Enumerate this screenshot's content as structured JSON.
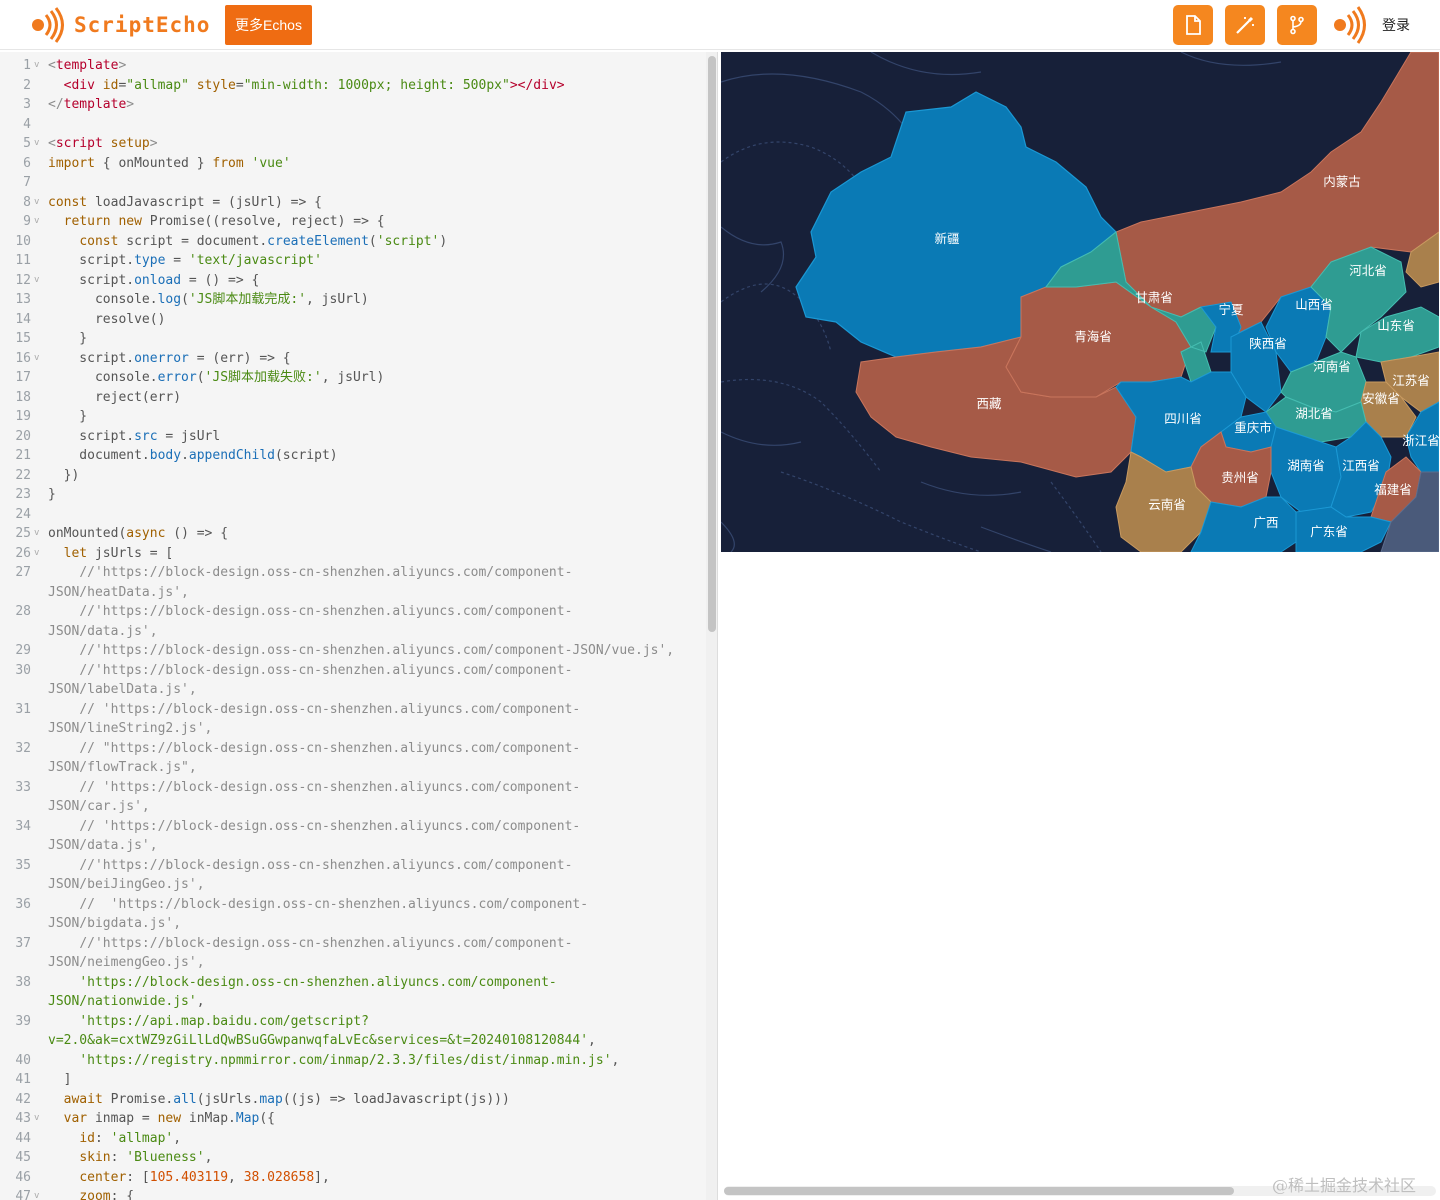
{
  "header": {
    "logo_text": "ScriptEcho",
    "more_button": "更多Echos",
    "login": "登录",
    "tools": [
      "file-icon",
      "magic-wand-icon",
      "branch-icon"
    ]
  },
  "editor": {
    "lines": [
      {
        "n": "1",
        "fold": true,
        "html": "<span class='cmt'>&lt;</span><span class='tag'>template</span><span class='cmt'>&gt;</span>"
      },
      {
        "n": "2",
        "html": "  <span class='tag'>&lt;div</span> <span class='kw'>id</span>=<span class='str'>\"allmap\"</span> <span class='kw'>style</span>=<span class='str'>\"min-width: 1000px; height: 500px\"</span><span class='tag'>&gt;&lt;/div&gt;</span>"
      },
      {
        "n": "3",
        "html": "<span class='cmt'>&lt;/</span><span class='tag'>template</span><span class='cmt'>&gt;</span>"
      },
      {
        "n": "4",
        "html": ""
      },
      {
        "n": "5",
        "fold": true,
        "html": "<span class='cmt'>&lt;</span><span class='tag'>script</span> <span class='kw'>setup</span><span class='cmt'>&gt;</span>"
      },
      {
        "n": "6",
        "html": "<span class='kw'>import</span> { onMounted } <span class='kw'>from</span> <span class='str'>'vue'</span>"
      },
      {
        "n": "7",
        "html": ""
      },
      {
        "n": "8",
        "fold": true,
        "html": "<span class='kw'>const</span> loadJavascript = (jsUrl) =&gt; {"
      },
      {
        "n": "9",
        "fold": true,
        "html": "  <span class='kw'>return</span> <span class='kw'>new</span> Promise((resolve, reject) =&gt; {"
      },
      {
        "n": "10",
        "html": "    <span class='kw'>const</span> script = document.<span class='fn'>createElement</span>(<span class='str'>'script'</span>)"
      },
      {
        "n": "11",
        "html": "    script.<span class='fn'>type</span> = <span class='str'>'text/javascript'</span>"
      },
      {
        "n": "12",
        "fold": true,
        "html": "    script.<span class='fn'>onload</span> = () =&gt; {"
      },
      {
        "n": "13",
        "html": "      console.<span class='fn'>log</span>(<span class='str'>'JS脚本加载完成:'</span>, jsUrl)"
      },
      {
        "n": "14",
        "html": "      resolve()"
      },
      {
        "n": "15",
        "html": "    }"
      },
      {
        "n": "16",
        "fold": true,
        "html": "    script.<span class='fn'>onerror</span> = (err) =&gt; {"
      },
      {
        "n": "17",
        "html": "      console.<span class='fn'>error</span>(<span class='str'>'JS脚本加载失败:'</span>, jsUrl)"
      },
      {
        "n": "18",
        "html": "      reject(err)"
      },
      {
        "n": "19",
        "html": "    }"
      },
      {
        "n": "20",
        "html": "    script.<span class='fn'>src</span> = jsUrl"
      },
      {
        "n": "21",
        "html": "    document.<span class='fn'>body</span>.<span class='fn'>appendChild</span>(script)"
      },
      {
        "n": "22",
        "html": "  })"
      },
      {
        "n": "23",
        "html": "}"
      },
      {
        "n": "24",
        "html": ""
      },
      {
        "n": "25",
        "fold": true,
        "html": "onMounted(<span class='kw'>async</span> () =&gt; {"
      },
      {
        "n": "26",
        "fold": true,
        "html": "  <span class='kw'>let</span> jsUrls = ["
      },
      {
        "n": "27",
        "html": "    <span class='cmt'>//'https://block-design.oss-cn-shenzhen.aliyuncs.com/component-</span>"
      },
      {
        "n": "",
        "html": "<span class='cmt'>JSON/heatData.js',</span>"
      },
      {
        "n": "28",
        "html": "    <span class='cmt'>//'https://block-design.oss-cn-shenzhen.aliyuncs.com/component-</span>"
      },
      {
        "n": "",
        "html": "<span class='cmt'>JSON/data.js',</span>"
      },
      {
        "n": "29",
        "html": "    <span class='cmt'>//'https://block-design.oss-cn-shenzhen.aliyuncs.com/component-JSON/vue.js',</span>"
      },
      {
        "n": "30",
        "html": "    <span class='cmt'>//'https://block-design.oss-cn-shenzhen.aliyuncs.com/component-</span>"
      },
      {
        "n": "",
        "html": "<span class='cmt'>JSON/labelData.js',</span>"
      },
      {
        "n": "31",
        "html": "    <span class='cmt'>// 'https://block-design.oss-cn-shenzhen.aliyuncs.com/component-</span>"
      },
      {
        "n": "",
        "html": "<span class='cmt'>JSON/lineString2.js',</span>"
      },
      {
        "n": "32",
        "html": "    <span class='cmt'>// \"https://block-design.oss-cn-shenzhen.aliyuncs.com/component-</span>"
      },
      {
        "n": "",
        "html": "<span class='cmt'>JSON/flowTrack.js\",</span>"
      },
      {
        "n": "33",
        "html": "    <span class='cmt'>// 'https://block-design.oss-cn-shenzhen.aliyuncs.com/component-</span>"
      },
      {
        "n": "",
        "html": "<span class='cmt'>JSON/car.js',</span>"
      },
      {
        "n": "34",
        "html": "    <span class='cmt'>// 'https://block-design.oss-cn-shenzhen.aliyuncs.com/component-</span>"
      },
      {
        "n": "",
        "html": "<span class='cmt'>JSON/data.js',</span>"
      },
      {
        "n": "35",
        "html": "    <span class='cmt'>//'https://block-design.oss-cn-shenzhen.aliyuncs.com/component-</span>"
      },
      {
        "n": "",
        "html": "<span class='cmt'>JSON/beiJingGeo.js',</span>"
      },
      {
        "n": "36",
        "html": "    <span class='cmt'>//  'https://block-design.oss-cn-shenzhen.aliyuncs.com/component-</span>"
      },
      {
        "n": "",
        "html": "<span class='cmt'>JSON/bigdata.js',</span>"
      },
      {
        "n": "37",
        "html": "    <span class='cmt'>//'https://block-design.oss-cn-shenzhen.aliyuncs.com/component-</span>"
      },
      {
        "n": "",
        "html": "<span class='cmt'>JSON/neimengGeo.js',</span>"
      },
      {
        "n": "38",
        "html": "    <span class='str'>'https://block-design.oss-cn-shenzhen.aliyuncs.com/component-</span>"
      },
      {
        "n": "",
        "html": "<span class='str'>JSON/nationwide.js'</span>,"
      },
      {
        "n": "39",
        "html": "    <span class='str'>'https://api.map.baidu.com/getscript?</span>"
      },
      {
        "n": "",
        "html": "<span class='str'>v=2.0&amp;ak=cxtWZ9zGiLlLdQwBSuGGwpanwqfaLvEc&amp;services=&amp;t=20240108120844'</span>,"
      },
      {
        "n": "40",
        "html": "    <span class='str'>'https://registry.npmmirror.com/inmap/2.3.3/files/dist/inmap.min.js'</span>,"
      },
      {
        "n": "41",
        "html": "  ]"
      },
      {
        "n": "42",
        "html": "  <span class='kw'>await</span> Promise.<span class='fn'>all</span>(jsUrls.<span class='fn'>map</span>((js) =&gt; loadJavascript(js)))"
      },
      {
        "n": "43",
        "fold": true,
        "html": "  <span class='kw'>var</span> inmap = <span class='kw'>new</span> inMap.<span class='fn'>Map</span>({"
      },
      {
        "n": "44",
        "html": "    <span class='kw'>id</span>: <span class='str'>'allmap'</span>,"
      },
      {
        "n": "45",
        "html": "    <span class='kw'>skin</span>: <span class='str'>'Blueness'</span>,"
      },
      {
        "n": "46",
        "html": "    <span class='kw'>center</span>: [<span class='num'>105.403119</span>, <span class='num'>38.028658</span>],"
      },
      {
        "n": "47",
        "fold": true,
        "html": "    <span class='kw'>zoom</span>: {"
      }
    ]
  },
  "map": {
    "colors": {
      "blue": "#0a7ab5",
      "rust": "#a65a47",
      "teal": "#2f9c92",
      "gold": "#a9804c",
      "bg": "#172039",
      "slate": "#4a5a7a"
    },
    "labels": [
      "新疆",
      "内蒙古",
      "甘肃省",
      "宁夏",
      "山西省",
      "河北省",
      "山东省",
      "青海省",
      "陕西省",
      "河南省",
      "江苏省",
      "西藏",
      "四川省",
      "湖北省",
      "安徽省",
      "重庆市",
      "浙江省",
      "湖南省",
      "江西省",
      "贵州省",
      "福建省",
      "云南省",
      "广西",
      "广东省"
    ]
  },
  "watermark": "@稀土掘金技术社区"
}
